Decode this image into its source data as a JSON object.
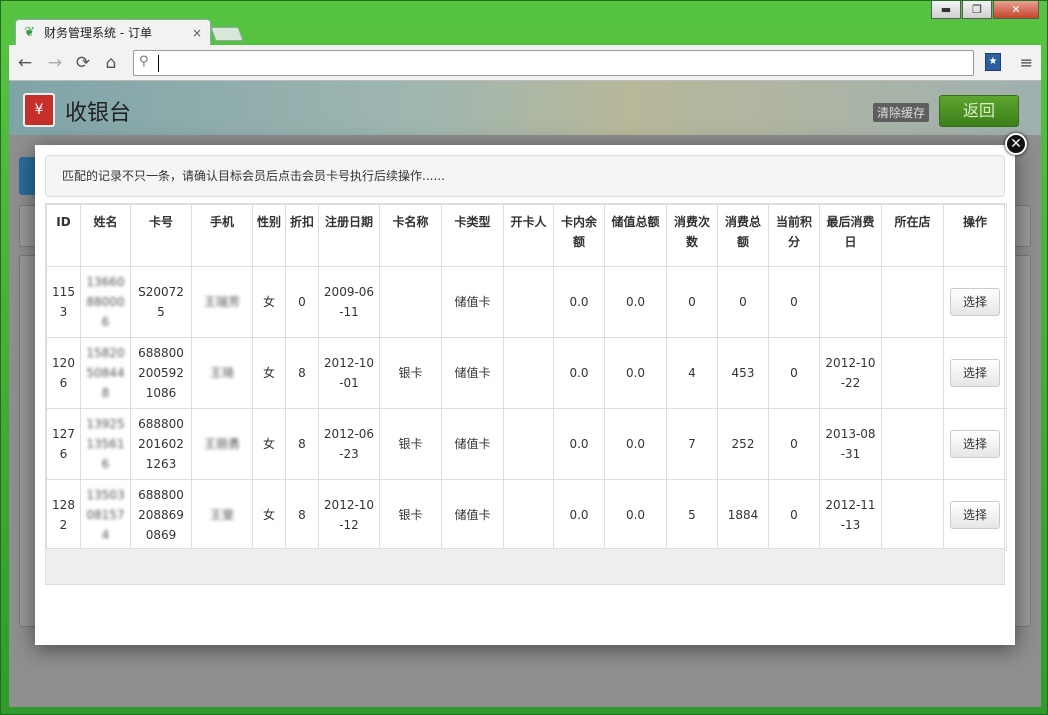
{
  "browser": {
    "tab_title": "财务管理系统 - 订单",
    "tab_close": "×",
    "minimize": "▬",
    "maximize": "❐",
    "close": "✕",
    "back": "←",
    "forward": "→",
    "reload": "⟳",
    "home": "⌂",
    "search_glyph": "⚲",
    "menu_glyph": "≡",
    "address_value": ""
  },
  "app": {
    "title": "收银台",
    "clear_cache": "清除缓存",
    "back_button": "返回"
  },
  "modal": {
    "close_glyph": "✕",
    "notice": "匹配的记录不只一条，请确认目标会员后点击会员卡号执行后续操作......",
    "columns": [
      "ID",
      "姓名",
      "卡号",
      "手机",
      "性别",
      "折扣",
      "注册日期",
      "卡名称",
      "卡类型",
      "开卡人",
      "卡内余额",
      "储值总额",
      "消费次数",
      "消费总额",
      "当前积分",
      "最后消费日",
      "所在店",
      "操作"
    ],
    "rows": [
      {
        "id": "1153",
        "name": "13660880006",
        "card": "S200725",
        "phone": "王瑞芳",
        "gender": "女",
        "discount": "0",
        "reg_date": "2009-06-11",
        "card_name": "",
        "card_type": "储值卡",
        "opener": "",
        "balance": "0.0",
        "stored_total": "0.0",
        "consume_count": "0",
        "consume_total": "0",
        "points": "0",
        "last_date": "",
        "store": "",
        "action": "选择"
      },
      {
        "id": "1206",
        "name": "15820508448",
        "card": "6888002005921086",
        "phone": "王琦",
        "gender": "女",
        "discount": "8",
        "reg_date": "2012-10-01",
        "card_name": "银卡",
        "card_type": "储值卡",
        "opener": "",
        "balance": "0.0",
        "stored_total": "0.0",
        "consume_count": "4",
        "consume_total": "453",
        "points": "0",
        "last_date": "2012-10-22",
        "store": "",
        "action": "选择"
      },
      {
        "id": "1276",
        "name": "13925135616",
        "card": "6888002016021263",
        "phone": "王丽勇",
        "gender": "女",
        "discount": "8",
        "reg_date": "2012-06-23",
        "card_name": "银卡",
        "card_type": "储值卡",
        "opener": "",
        "balance": "0.0",
        "stored_total": "0.0",
        "consume_count": "7",
        "consume_total": "252",
        "points": "0",
        "last_date": "2013-08-31",
        "store": "",
        "action": "选择"
      },
      {
        "id": "1282",
        "name": "13503081574",
        "card": "6888002088690869",
        "phone": "王斐",
        "gender": "女",
        "discount": "8",
        "reg_date": "2012-10-12",
        "card_name": "银卡",
        "card_type": "储值卡",
        "opener": "",
        "balance": "0.0",
        "stored_total": "0.0",
        "consume_count": "5",
        "consume_total": "1884",
        "points": "0",
        "last_date": "2012-11-13",
        "store": "",
        "action": "选择"
      }
    ]
  }
}
